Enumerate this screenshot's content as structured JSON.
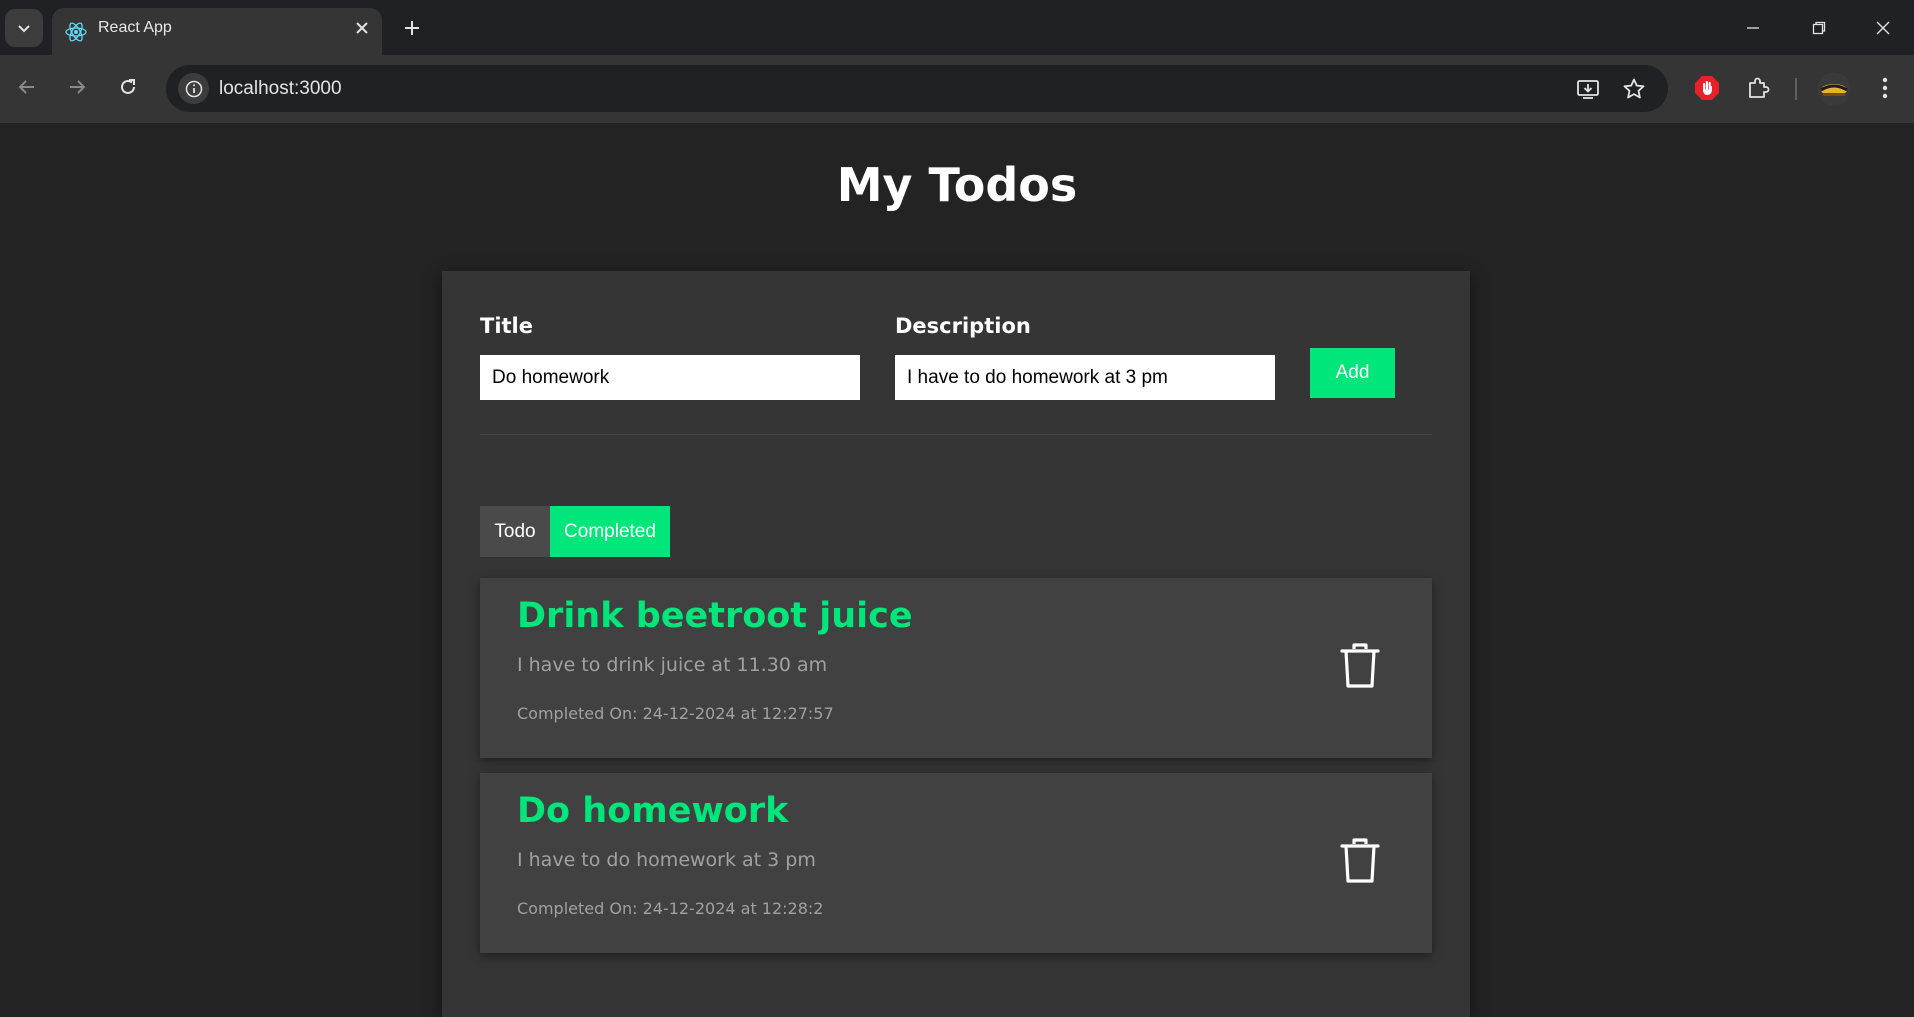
{
  "browser": {
    "tab_title": "React App",
    "url": "localhost:3000"
  },
  "page": {
    "heading": "My Todos",
    "form": {
      "title_label": "Title",
      "title_value": "Do homework",
      "description_label": "Description",
      "description_value": "I have to do homework at 3 pm",
      "add_label": "Add"
    },
    "tabs": [
      {
        "label": "Todo",
        "active": false
      },
      {
        "label": "Completed",
        "active": true
      }
    ],
    "items": [
      {
        "title": "Drink beetroot juice",
        "description": "I have to drink juice at 11.30 am",
        "completed_on": "Completed On: 24-12-2024 at 12:27:57"
      },
      {
        "title": "Do homework",
        "description": "I have to do homework at 3 pm",
        "completed_on": "Completed On: 24-12-2024 at 12:28:2"
      }
    ]
  },
  "colors": {
    "accent": "#00e67a",
    "background": "#232323",
    "panel": "#353535",
    "card": "#414141"
  }
}
